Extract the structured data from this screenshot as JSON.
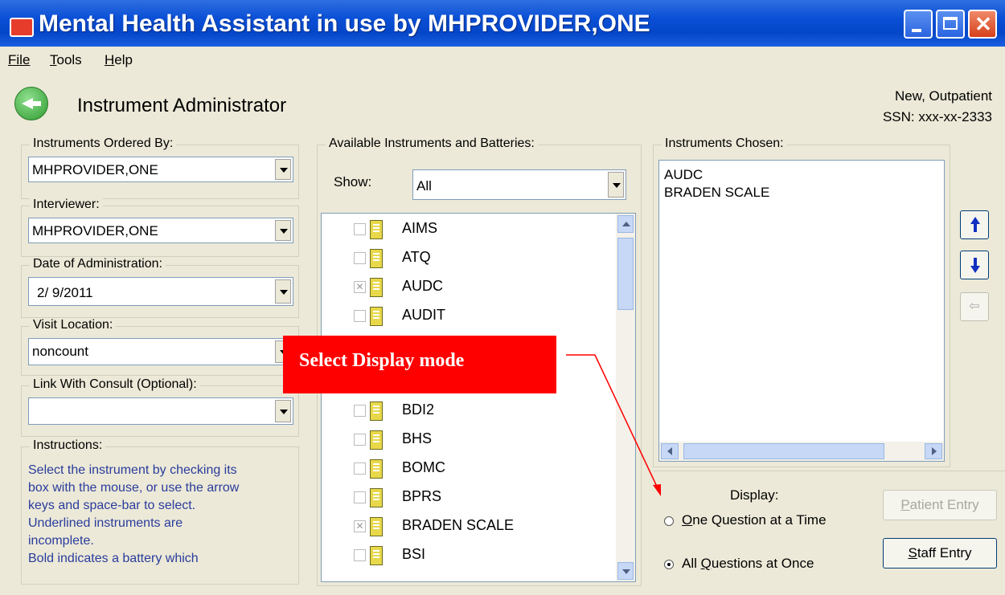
{
  "window": {
    "title": "Mental Health Assistant in use by MHPROVIDER,ONE"
  },
  "menu": {
    "file": "File",
    "tools": "Tools",
    "help": "Help"
  },
  "header": {
    "title": "Instrument Administrator",
    "patient_status": "New, Outpatient",
    "ssn": "SSN: xxx-xx-2333"
  },
  "left": {
    "ordered_by": {
      "label": "Instruments Ordered By:",
      "value": "MHPROVIDER,ONE"
    },
    "interviewer": {
      "label": "Interviewer:",
      "value": "MHPROVIDER,ONE"
    },
    "date": {
      "label": "Date of Administration:",
      "value": "2/ 9/2011"
    },
    "location": {
      "label": "Visit Location:",
      "value": "noncount"
    },
    "consult": {
      "label": "Link With Consult (Optional):",
      "value": ""
    },
    "instructions": {
      "label": "Instructions:",
      "text": [
        " Select the instrument by checking its",
        "box with the mouse, or use the arrow",
        "keys and space-bar to select.",
        "  Underlined instruments are",
        "incomplete.",
        "  Bold indicates a battery which"
      ]
    }
  },
  "middle": {
    "label": "Available Instruments and Batteries:",
    "show_label": "Show:",
    "show_value": "All",
    "items": [
      {
        "name": "AIMS",
        "checked": false
      },
      {
        "name": "ATQ",
        "checked": false
      },
      {
        "name": "AUDC",
        "checked": true
      },
      {
        "name": "AUDIT",
        "checked": false
      },
      {
        "name": "BDI2",
        "checked": false
      },
      {
        "name": "BHS",
        "checked": false
      },
      {
        "name": "BOMC",
        "checked": false
      },
      {
        "name": "BPRS",
        "checked": false
      },
      {
        "name": "BRADEN SCALE",
        "checked": true
      },
      {
        "name": "BSI",
        "checked": false
      }
    ]
  },
  "right": {
    "label": "Instruments Chosen:",
    "chosen": [
      "AUDC",
      "BRADEN SCALE"
    ],
    "display_label": "Display:",
    "one_question": "One Question at a Time",
    "all_questions": "All Questions at Once",
    "selected_mode": "all",
    "patient_entry": "Patient Entry",
    "staff_entry": "Staff Entry"
  },
  "annotation": {
    "text": "Select Display mode"
  },
  "colors": {
    "titlebar": "#0a4fd6",
    "callout": "#ff0000",
    "instruction_text": "#2a3c9c"
  }
}
